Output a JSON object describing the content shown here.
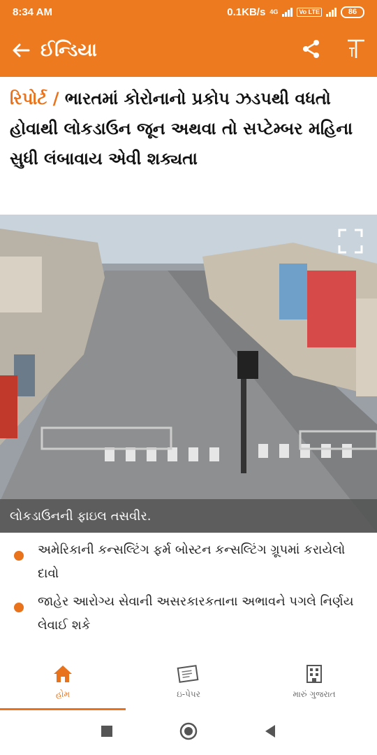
{
  "status_bar": {
    "time": "8:34 AM",
    "speed": "0.1KB/s",
    "network": "4G",
    "volte": "Vo LTE",
    "battery": "86"
  },
  "app_bar": {
    "title": "ઈન્ડિયા",
    "icons": [
      "back-arrow-icon",
      "share-icon",
      "font-size-icon"
    ]
  },
  "article": {
    "tag": "રિપોર્ટ /",
    "headline": "ભારતમાં કોરોનાનો પ્રકોપ ઝડપથી વધતો હોવાથી લોકડાઉન જૂન અથવા તો સપ્ટેમ્બર મહિના સુધી લંબાવાય એવી શક્યતા",
    "image_caption": "લોકડાઉનની ફાઇલ તસવીર.",
    "bullets": [
      "અમેરિકાની કન્સલ્ટિંગ ફર્મ બોસ્ટન કન્સલ્ટિંગ ગ્રૂપમાં કરાયેલો દાવો",
      "જાહેર આરોગ્ય સેવાની અસરકારકતાના અભાવને પગલે નિર્ણય લેવાઈ શકે"
    ]
  },
  "bottom_nav": {
    "items": [
      {
        "label": "હોમ",
        "icon": "home-icon",
        "active": true
      },
      {
        "label": "ઇ-પેપર",
        "icon": "epaper-icon",
        "active": false
      },
      {
        "label": "મારું ગુજરાત",
        "icon": "building-icon",
        "active": false
      }
    ]
  },
  "colors": {
    "brand": "#ee7a1f",
    "accent": "#e8731c"
  }
}
